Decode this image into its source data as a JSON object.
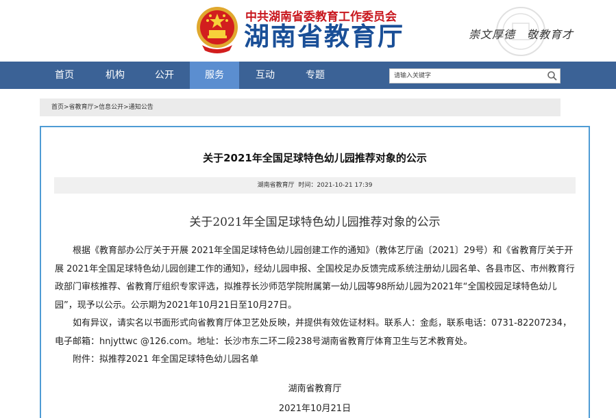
{
  "header": {
    "org_name": "中共湖南省委教育工作委员会",
    "dept_name": "湖南省教育厅",
    "motto": "崇文厚德　敬教育才"
  },
  "nav": {
    "items": [
      {
        "label": "首页"
      },
      {
        "label": "机构"
      },
      {
        "label": "公开"
      },
      {
        "label": "服务"
      },
      {
        "label": "互动"
      },
      {
        "label": "专题"
      }
    ],
    "active_label": "服务",
    "search_placeholder": "请输入关键字"
  },
  "breadcrumb": {
    "items": [
      "首页",
      "省教育厅",
      "信息公开",
      "通知公告"
    ],
    "separator": ">"
  },
  "article": {
    "title": "关于2021年全国足球特色幼儿园推荐对象的公示",
    "source": "湖南省教育厅",
    "time_label": "时间：",
    "time": "2021-10-21 17:39",
    "subtitle": "关于2021年全国足球特色幼儿园推荐对象的公示",
    "paragraphs": [
      "根据《教育部办公厅关于开展 2021年全国足球特色幼儿园创建工作的通知》（教体艺厅函〔2021〕29号）和《省教育厅关于开展 2021年全国足球特色幼儿园创建工作的通知》，经幼儿园申报、全国校足办反馈完成系统注册幼儿园名单、各县市区、市州教育行政部门审核推荐、省教育厅组织专家评选，拟推荐长沙师范学院附属第一幼儿园等98所幼儿园为2021年“全国校园足球特色幼儿园”，现予以公示。公示期为2021年10月21日至10月27日。",
      "如有异议，请实名以书面形式向省教育厅体卫艺处反映，并提供有效佐证材料。联系人：金彪，联系电话：0731-82207234，电子邮箱：hnjyttwc @126.com。地址：长沙市东二环二段238号湖南省教育厅体育卫生与艺术教育处。",
      "附件：拟推荐2021  年全国足球特色幼儿园名单"
    ],
    "signature": "湖南省教育厅",
    "date": "2021年10月21日"
  },
  "colors": {
    "nav_bg": "#3b6296",
    "nav_active": "#5b8ed0",
    "brand_blue": "#1a4f97",
    "brand_red": "#c8161d",
    "frame_border": "#4e9bd4"
  }
}
